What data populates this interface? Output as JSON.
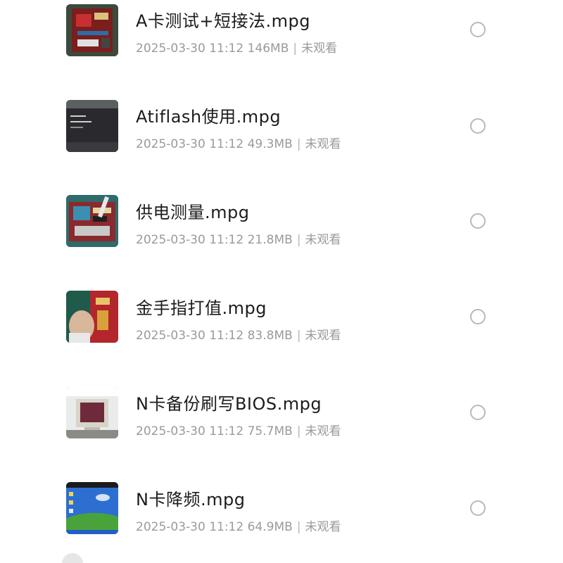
{
  "files": [
    {
      "name": "A卡测试+短接法.mpg",
      "date": "2025-03-30 11:12",
      "size": "146MB",
      "status": "未观看",
      "thumb": "motherboard-red"
    },
    {
      "name": "Atiflash使用.mpg",
      "date": "2025-03-30 11:12",
      "size": "49.3MB",
      "status": "未观看",
      "thumb": "dark-terminal"
    },
    {
      "name": "供电测量.mpg",
      "date": "2025-03-30 11:12",
      "size": "21.8MB",
      "status": "未观看",
      "thumb": "circuit-board-probe"
    },
    {
      "name": "金手指打值.mpg",
      "date": "2025-03-30 11:12",
      "size": "83.8MB",
      "status": "未观看",
      "thumb": "hand-red-board"
    },
    {
      "name": "N卡备份刷写BIOS.mpg",
      "date": "2025-03-30 11:12",
      "size": "75.7MB",
      "status": "未观看",
      "thumb": "crt-monitor"
    },
    {
      "name": "N卡降频.mpg",
      "date": "2025-03-30 11:12",
      "size": "64.9MB",
      "status": "未观看",
      "thumb": "windows-xp-desktop"
    }
  ],
  "colors": {
    "title": "#1c1c1c",
    "meta": "#9a9a9a",
    "radio_border": "#b9b9b9"
  }
}
